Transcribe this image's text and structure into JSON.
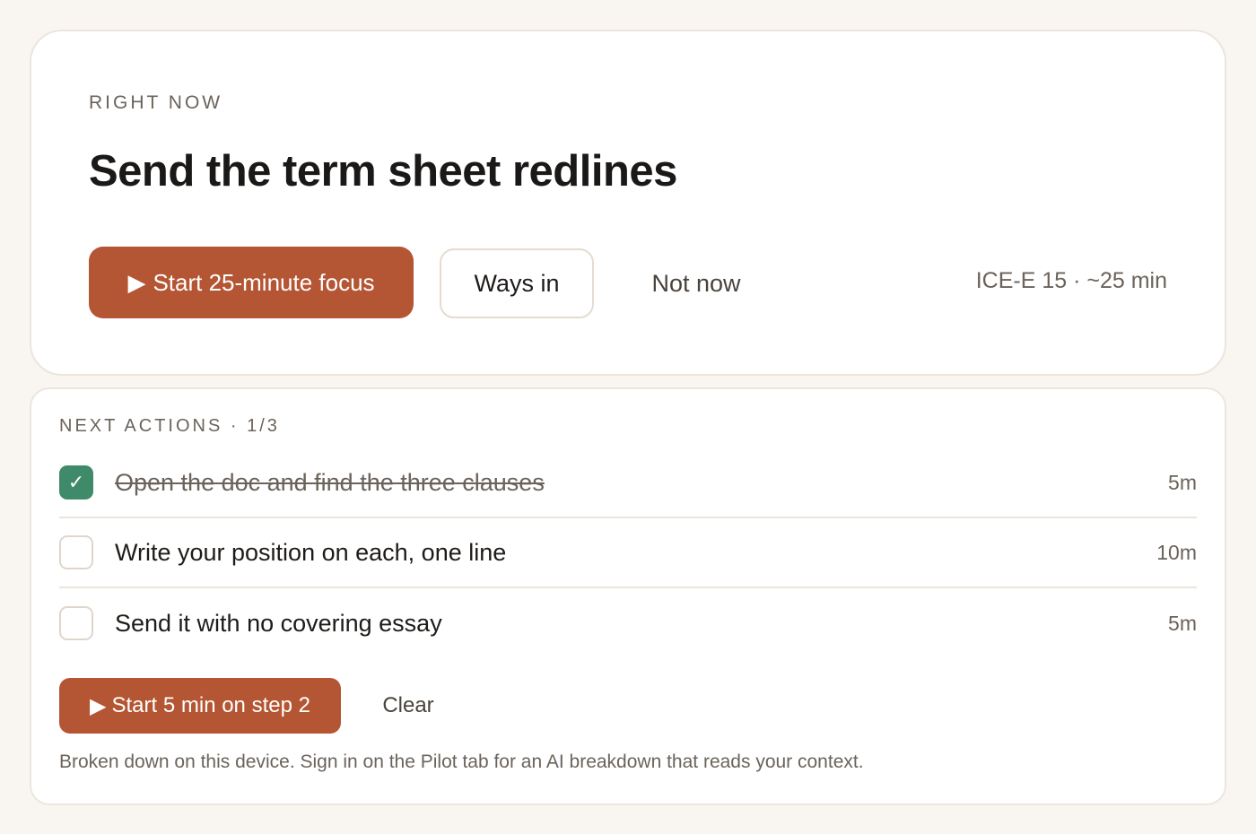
{
  "focus_card": {
    "eyebrow": "RIGHT NOW",
    "title": "Send the term sheet redlines",
    "start_button": {
      "icon": "play-icon",
      "glyph": "▶",
      "label": "Start 25-minute focus"
    },
    "ways_in_label": "Ways in",
    "not_now_label": "Not now",
    "meta": "ICE-E 15 · ~25 min"
  },
  "next_actions": {
    "label": "NEXT ACTIONS · 1/3",
    "items": [
      {
        "text": "Open the doc and find the three clauses",
        "duration": "5m",
        "done": true
      },
      {
        "text": "Write your position on each, one line",
        "duration": "10m",
        "done": false
      },
      {
        "text": "Send it with no covering essay",
        "duration": "5m",
        "done": false
      }
    ],
    "check_glyph": "✓",
    "step_button": {
      "icon": "play-icon",
      "glyph": "▶",
      "label": "Start 5 min on step 2"
    },
    "clear_label": "Clear",
    "footnote": "Broken down on this device. Sign in on the Pilot tab for an AI breakdown that reads your context."
  },
  "colors": {
    "background": "#f9f6f1",
    "accent": "#b45533",
    "done_green": "#3f8a68",
    "muted_text": "#6b635b"
  }
}
